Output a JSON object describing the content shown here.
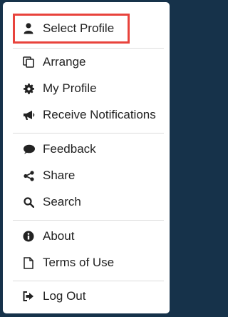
{
  "menu": {
    "items": [
      {
        "id": "select-profile",
        "label": "Select Profile",
        "icon": "user-icon"
      },
      {
        "id": "arrange",
        "label": "Arrange",
        "icon": "copy-icon"
      },
      {
        "id": "my-profile",
        "label": "My Profile",
        "icon": "gear-icon"
      },
      {
        "id": "receive-notifications",
        "label": "Receive Notifications",
        "icon": "megaphone-icon"
      },
      {
        "id": "feedback",
        "label": "Feedback",
        "icon": "comment-icon"
      },
      {
        "id": "share",
        "label": "Share",
        "icon": "share-icon"
      },
      {
        "id": "search",
        "label": "Search",
        "icon": "search-icon"
      },
      {
        "id": "about",
        "label": "About",
        "icon": "info-icon"
      },
      {
        "id": "terms-of-use",
        "label": "Terms of Use",
        "icon": "document-icon"
      },
      {
        "id": "log-out",
        "label": "Log Out",
        "icon": "sign-out-icon"
      }
    ]
  },
  "colors": {
    "highlight": "#e8433c",
    "background": "#16324a",
    "text": "#222222"
  }
}
